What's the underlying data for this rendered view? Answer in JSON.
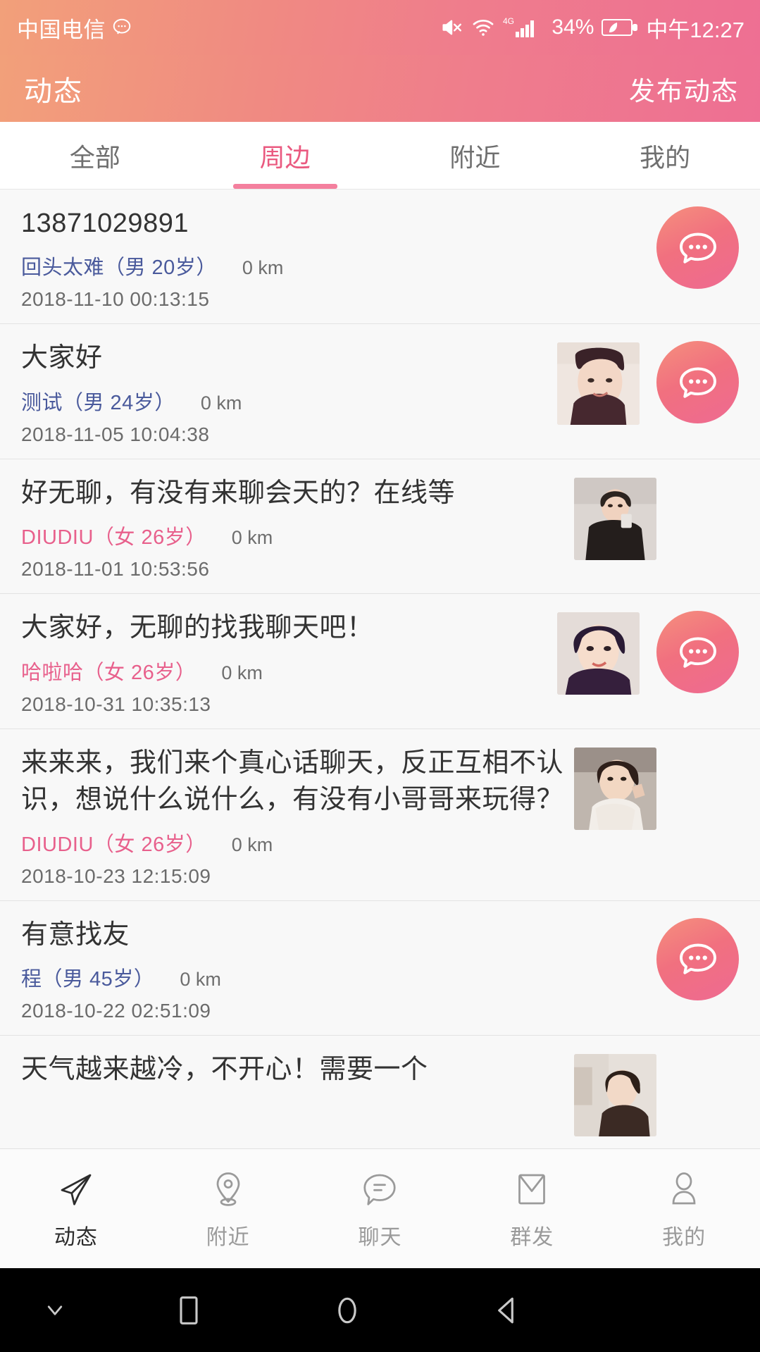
{
  "status_bar": {
    "carrier": "中国电信",
    "battery_percent": "34%",
    "time": "中午12:27",
    "icons": [
      "mute-icon",
      "wifi-icon",
      "4g-icon",
      "signal-icon",
      "battery-icon"
    ],
    "network_label": "4G"
  },
  "header": {
    "title": "动态",
    "action_label": "发布动态",
    "gradient_start": "#f2a07a",
    "gradient_end": "#ee6f93"
  },
  "tabs": {
    "active_index": 1,
    "accent_color": "#ea5a80",
    "items": [
      {
        "label": "全部"
      },
      {
        "label": "周边"
      },
      {
        "label": "附近"
      },
      {
        "label": "我的"
      }
    ]
  },
  "feed": {
    "posts": [
      {
        "text": "13871029891",
        "author": "回头太难（男 20岁）",
        "gender": "male",
        "distance": "0 km",
        "timestamp": "2018-11-10 00:13:15",
        "has_thumbnail": false,
        "has_chat_button": true
      },
      {
        "text": "大家好",
        "author": "测试（男 24岁）",
        "gender": "male",
        "distance": "0 km",
        "timestamp": "2018-11-05 10:04:38",
        "has_thumbnail": true,
        "has_chat_button": true
      },
      {
        "text": "好无聊，有没有来聊会天的？在线等",
        "author": "DIUDIU（女 26岁）",
        "gender": "female",
        "distance": "0 km",
        "timestamp": "2018-11-01 10:53:56",
        "has_thumbnail": true,
        "has_chat_button": false
      },
      {
        "text": "大家好，无聊的找我聊天吧！",
        "author": "哈啦哈（女 26岁）",
        "gender": "female",
        "distance": "0 km",
        "timestamp": "2018-10-31 10:35:13",
        "has_thumbnail": true,
        "has_chat_button": true
      },
      {
        "text": "来来来，我们来个真心话聊天，反正互相不认识，想说什么说什么，有没有小哥哥来玩得？",
        "author": "DIUDIU（女 26岁）",
        "gender": "female",
        "distance": "0 km",
        "timestamp": "2018-10-23 12:15:09",
        "has_thumbnail": true,
        "has_chat_button": false
      },
      {
        "text": "有意找友",
        "author": "程（男 45岁）",
        "gender": "male",
        "distance": "0 km",
        "timestamp": "2018-10-22 02:51:09",
        "has_thumbnail": false,
        "has_chat_button": true
      },
      {
        "text": "天气越来越冷，不开心！需要一个",
        "author": "",
        "gender": "female",
        "distance": "",
        "timestamp": "",
        "has_thumbnail": true,
        "has_chat_button": false
      }
    ]
  },
  "bottom_nav": {
    "active_index": 0,
    "items": [
      {
        "label": "动态",
        "icon": "paper-plane-icon"
      },
      {
        "label": "附近",
        "icon": "map-pin-icon"
      },
      {
        "label": "聊天",
        "icon": "chat-bubble-icon"
      },
      {
        "label": "群发",
        "icon": "broadcast-envelope-icon"
      },
      {
        "label": "我的",
        "icon": "person-icon"
      }
    ]
  },
  "system_nav": {
    "items": [
      "hide-keyboard-icon",
      "recents-icon",
      "home-icon",
      "back-icon"
    ]
  }
}
